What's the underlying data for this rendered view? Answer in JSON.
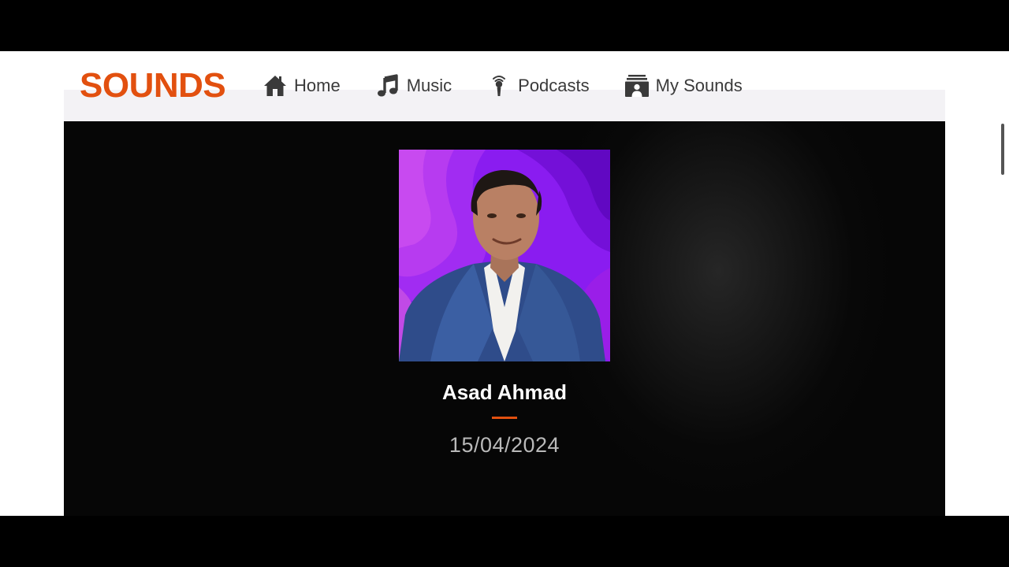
{
  "app": {
    "logo_text": "SOUNDS",
    "brand_color": "#e2500f"
  },
  "nav": {
    "items": [
      {
        "label": "Home",
        "icon": "home-icon"
      },
      {
        "label": "Music",
        "icon": "music-note-icon"
      },
      {
        "label": "Podcasts",
        "icon": "podcast-microphone-icon"
      },
      {
        "label": "My Sounds",
        "icon": "my-sounds-icon"
      }
    ]
  },
  "episode": {
    "title": "Asad Ahmad",
    "date": "15/04/2024",
    "artwork_background": "#8a1cf0"
  }
}
